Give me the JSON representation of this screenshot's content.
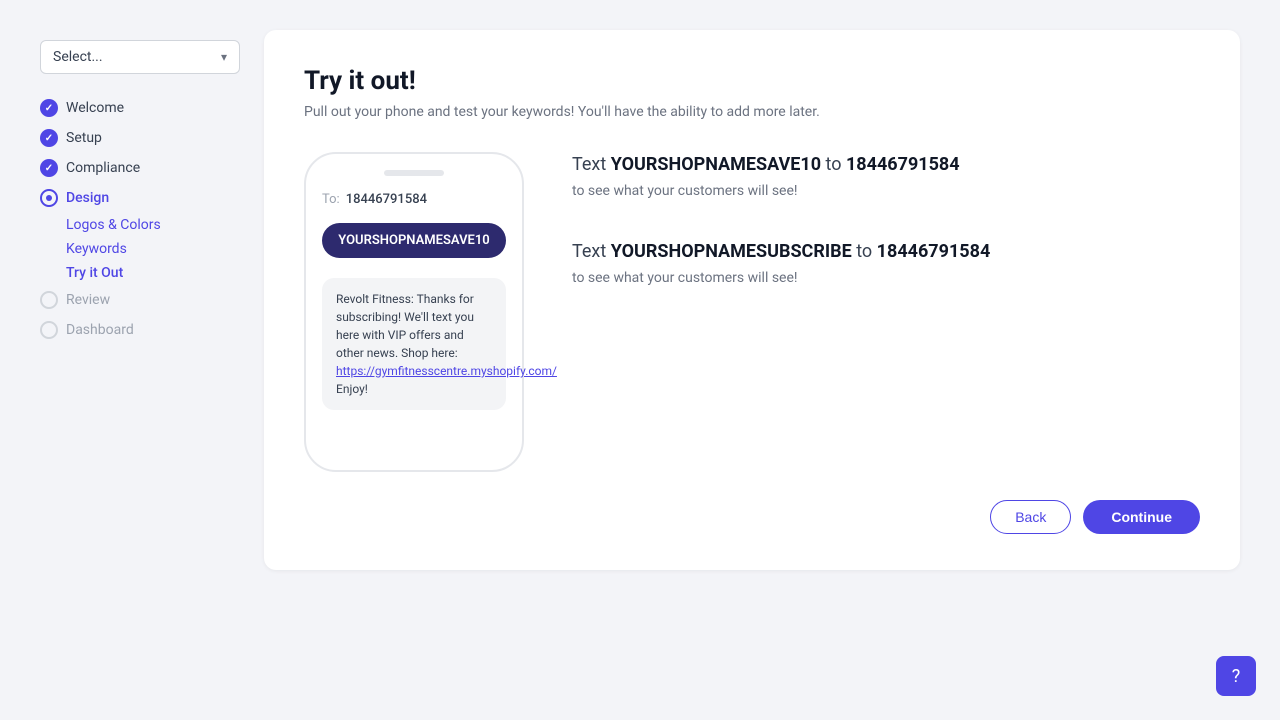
{
  "sidebar": {
    "select_placeholder": "Select...",
    "nav_items": [
      {
        "id": "welcome",
        "label": "Welcome",
        "state": "checked"
      },
      {
        "id": "setup",
        "label": "Setup",
        "state": "checked"
      },
      {
        "id": "compliance",
        "label": "Compliance",
        "state": "checked"
      },
      {
        "id": "design",
        "label": "Design",
        "state": "active",
        "sub_items": [
          {
            "id": "logos-colors",
            "label": "Logos & Colors"
          },
          {
            "id": "keywords",
            "label": "Keywords"
          },
          {
            "id": "try-it-out",
            "label": "Try it Out"
          }
        ]
      },
      {
        "id": "review",
        "label": "Review",
        "state": "gray"
      },
      {
        "id": "dashboard",
        "label": "Dashboard",
        "state": "gray"
      }
    ]
  },
  "main": {
    "title": "Try it out!",
    "subtitle": "Pull out your phone and test your keywords! You'll have the ability to add more later.",
    "phone": {
      "top_bar": "",
      "to_label": "To:",
      "to_number": "18446791584",
      "keyword_button": "YOURSHOPNAMESAVE10",
      "message": "Revolt Fitness: Thanks for subscribing! We'll text you here with VIP offers and other news. Shop here: ",
      "message_link": "https://gymfitnesscentre.myshopify.com/",
      "message_suffix": " Enjoy!"
    },
    "instructions": [
      {
        "id": "instruction-1",
        "prefix": "Text ",
        "keyword": "YOURSHOPNAMESAVE10",
        "middle": " to ",
        "number": "18446791584",
        "sub": "to see what your customers will see!"
      },
      {
        "id": "instruction-2",
        "prefix": "Text ",
        "keyword": "YOURSHOPNAMESUBSCRIBE",
        "middle": " to ",
        "number": "18446791584",
        "sub": "to see what your customers will see!"
      }
    ],
    "buttons": {
      "back": "Back",
      "continue": "Continue"
    }
  },
  "help": {
    "icon": "?"
  }
}
